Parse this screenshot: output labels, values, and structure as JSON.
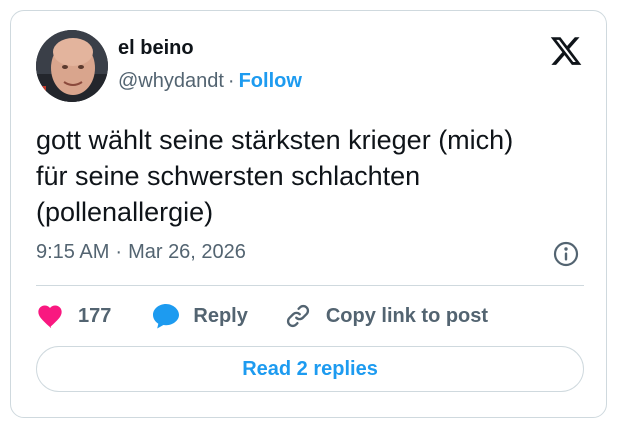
{
  "author": {
    "display_name": "el beino",
    "handle": "@whydandt",
    "separator": "·",
    "follow_label": "Follow"
  },
  "tweet": {
    "text_lines": [
      "gott wählt seine stärksten krieger (mich)",
      "für seine schwersten schlachten",
      "(pollenallergie)"
    ],
    "time": "9:15 AM",
    "separator": "·",
    "date": "Mar 26, 2026"
  },
  "actions": {
    "like_count": "177",
    "reply_label": "Reply",
    "copy_link_label": "Copy link to post"
  },
  "read_replies_label": "Read 2 replies",
  "colors": {
    "accent": "#1d9bf0",
    "like": "#f91880",
    "text_primary": "#0f1419",
    "text_secondary": "#536471",
    "border": "#cfd9de"
  },
  "icons": {
    "brand": "x-logo-icon",
    "info": "info-icon",
    "like": "heart-icon",
    "reply": "speech-bubble-icon",
    "copy_link": "link-icon"
  }
}
